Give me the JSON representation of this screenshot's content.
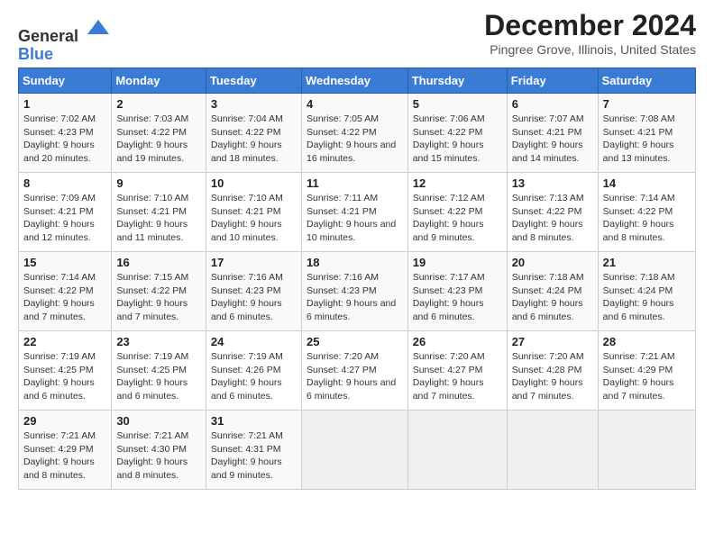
{
  "logo": {
    "text_general": "General",
    "text_blue": "Blue"
  },
  "title": "December 2024",
  "subtitle": "Pingree Grove, Illinois, United States",
  "days_of_week": [
    "Sunday",
    "Monday",
    "Tuesday",
    "Wednesday",
    "Thursday",
    "Friday",
    "Saturday"
  ],
  "weeks": [
    [
      {
        "day": "1",
        "sunrise": "7:02 AM",
        "sunset": "4:23 PM",
        "daylight": "9 hours and 20 minutes."
      },
      {
        "day": "2",
        "sunrise": "7:03 AM",
        "sunset": "4:22 PM",
        "daylight": "9 hours and 19 minutes."
      },
      {
        "day": "3",
        "sunrise": "7:04 AM",
        "sunset": "4:22 PM",
        "daylight": "9 hours and 18 minutes."
      },
      {
        "day": "4",
        "sunrise": "7:05 AM",
        "sunset": "4:22 PM",
        "daylight": "9 hours and 16 minutes."
      },
      {
        "day": "5",
        "sunrise": "7:06 AM",
        "sunset": "4:22 PM",
        "daylight": "9 hours and 15 minutes."
      },
      {
        "day": "6",
        "sunrise": "7:07 AM",
        "sunset": "4:21 PM",
        "daylight": "9 hours and 14 minutes."
      },
      {
        "day": "7",
        "sunrise": "7:08 AM",
        "sunset": "4:21 PM",
        "daylight": "9 hours and 13 minutes."
      }
    ],
    [
      {
        "day": "8",
        "sunrise": "7:09 AM",
        "sunset": "4:21 PM",
        "daylight": "9 hours and 12 minutes."
      },
      {
        "day": "9",
        "sunrise": "7:10 AM",
        "sunset": "4:21 PM",
        "daylight": "9 hours and 11 minutes."
      },
      {
        "day": "10",
        "sunrise": "7:10 AM",
        "sunset": "4:21 PM",
        "daylight": "9 hours and 10 minutes."
      },
      {
        "day": "11",
        "sunrise": "7:11 AM",
        "sunset": "4:21 PM",
        "daylight": "9 hours and 10 minutes."
      },
      {
        "day": "12",
        "sunrise": "7:12 AM",
        "sunset": "4:22 PM",
        "daylight": "9 hours and 9 minutes."
      },
      {
        "day": "13",
        "sunrise": "7:13 AM",
        "sunset": "4:22 PM",
        "daylight": "9 hours and 8 minutes."
      },
      {
        "day": "14",
        "sunrise": "7:14 AM",
        "sunset": "4:22 PM",
        "daylight": "9 hours and 8 minutes."
      }
    ],
    [
      {
        "day": "15",
        "sunrise": "7:14 AM",
        "sunset": "4:22 PM",
        "daylight": "9 hours and 7 minutes."
      },
      {
        "day": "16",
        "sunrise": "7:15 AM",
        "sunset": "4:22 PM",
        "daylight": "9 hours and 7 minutes."
      },
      {
        "day": "17",
        "sunrise": "7:16 AM",
        "sunset": "4:23 PM",
        "daylight": "9 hours and 6 minutes."
      },
      {
        "day": "18",
        "sunrise": "7:16 AM",
        "sunset": "4:23 PM",
        "daylight": "9 hours and 6 minutes."
      },
      {
        "day": "19",
        "sunrise": "7:17 AM",
        "sunset": "4:23 PM",
        "daylight": "9 hours and 6 minutes."
      },
      {
        "day": "20",
        "sunrise": "7:18 AM",
        "sunset": "4:24 PM",
        "daylight": "9 hours and 6 minutes."
      },
      {
        "day": "21",
        "sunrise": "7:18 AM",
        "sunset": "4:24 PM",
        "daylight": "9 hours and 6 minutes."
      }
    ],
    [
      {
        "day": "22",
        "sunrise": "7:19 AM",
        "sunset": "4:25 PM",
        "daylight": "9 hours and 6 minutes."
      },
      {
        "day": "23",
        "sunrise": "7:19 AM",
        "sunset": "4:25 PM",
        "daylight": "9 hours and 6 minutes."
      },
      {
        "day": "24",
        "sunrise": "7:19 AM",
        "sunset": "4:26 PM",
        "daylight": "9 hours and 6 minutes."
      },
      {
        "day": "25",
        "sunrise": "7:20 AM",
        "sunset": "4:27 PM",
        "daylight": "9 hours and 6 minutes."
      },
      {
        "day": "26",
        "sunrise": "7:20 AM",
        "sunset": "4:27 PM",
        "daylight": "9 hours and 7 minutes."
      },
      {
        "day": "27",
        "sunrise": "7:20 AM",
        "sunset": "4:28 PM",
        "daylight": "9 hours and 7 minutes."
      },
      {
        "day": "28",
        "sunrise": "7:21 AM",
        "sunset": "4:29 PM",
        "daylight": "9 hours and 7 minutes."
      }
    ],
    [
      {
        "day": "29",
        "sunrise": "7:21 AM",
        "sunset": "4:29 PM",
        "daylight": "9 hours and 8 minutes."
      },
      {
        "day": "30",
        "sunrise": "7:21 AM",
        "sunset": "4:30 PM",
        "daylight": "9 hours and 8 minutes."
      },
      {
        "day": "31",
        "sunrise": "7:21 AM",
        "sunset": "4:31 PM",
        "daylight": "9 hours and 9 minutes."
      },
      null,
      null,
      null,
      null
    ]
  ]
}
